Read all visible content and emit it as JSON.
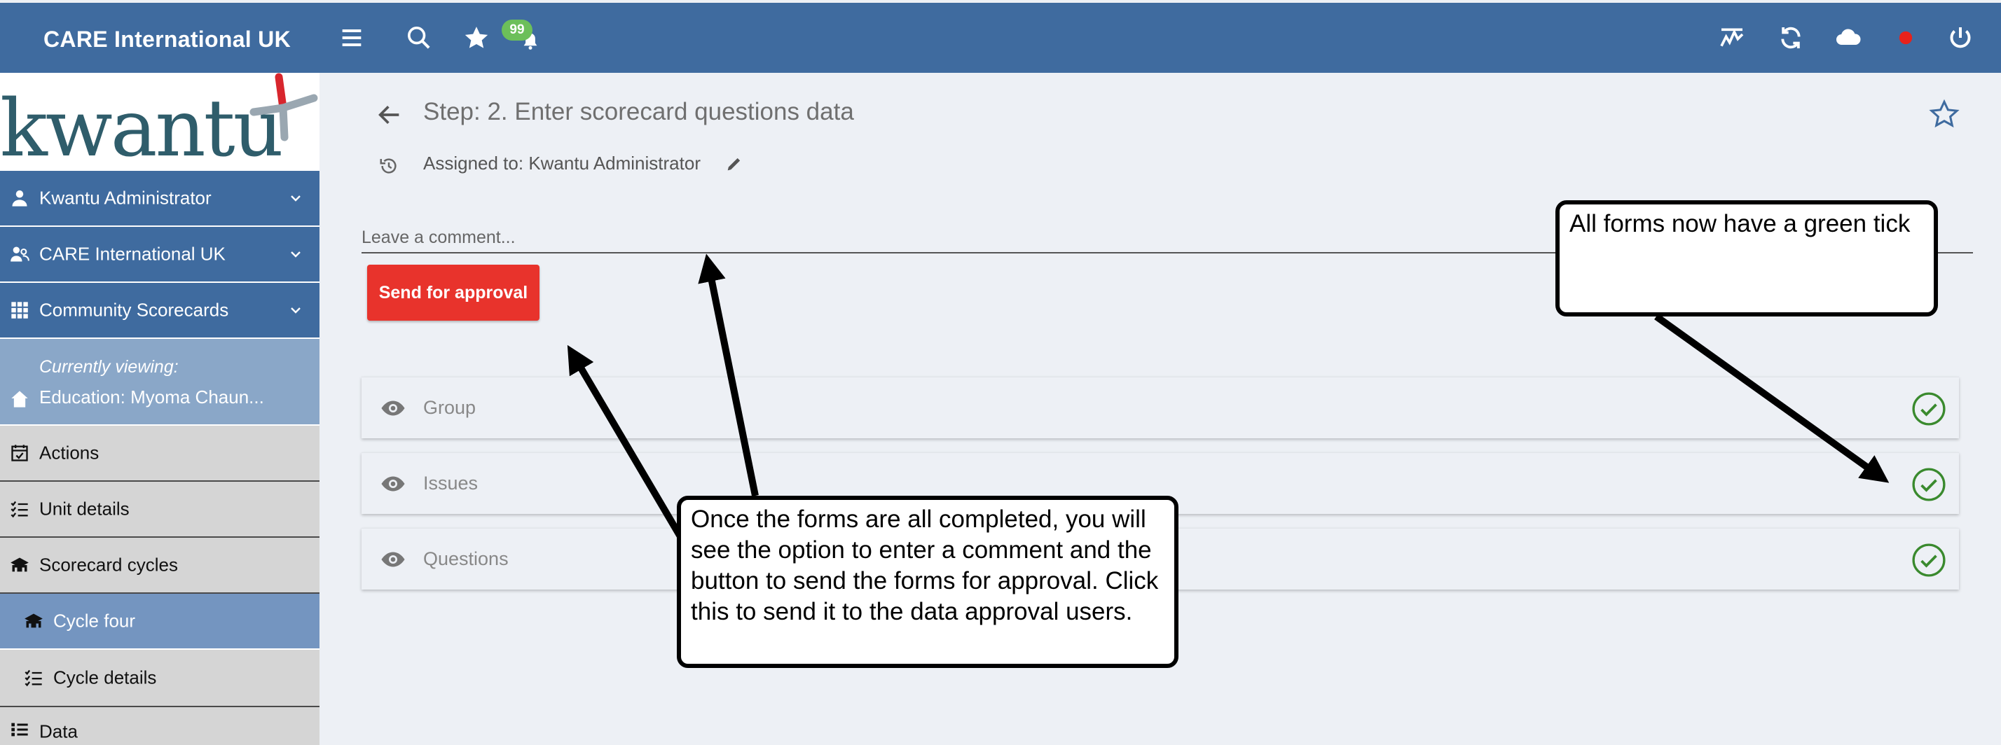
{
  "header": {
    "org_name": "CARE International UK",
    "notification_count": "99",
    "icons": [
      "menu-icon",
      "search-icon",
      "star-icon",
      "bell-icon",
      "activity-icon",
      "sync-icon",
      "cloud-icon",
      "status-dot-icon",
      "power-icon"
    ],
    "status_dot_color": "#e8221b"
  },
  "sidebar": {
    "logo_text": "kwantu",
    "user": "Kwantu Administrator",
    "organisation": "CARE International UK",
    "app": "Community Scorecards",
    "viewing_label": "Currently viewing:",
    "viewing_value": "Education: Myoma Chaun...",
    "items": {
      "actions": "Actions",
      "unit_details": "Unit details",
      "scorecard_cycles": "Scorecard cycles",
      "cycle_four": "Cycle four",
      "cycle_details": "Cycle details",
      "data": "Data"
    }
  },
  "main": {
    "step_title": "Step: 2. Enter scorecard questions data",
    "assigned_to": "Assigned to: Kwantu Administrator",
    "comment_placeholder": "Leave a comment...",
    "send_button": "Send for approval",
    "forms": [
      {
        "name": "Group",
        "status": "complete"
      },
      {
        "name": "Issues",
        "status": "complete"
      },
      {
        "name": "Questions",
        "status": "complete"
      }
    ],
    "tick_color": "#3a8a2e"
  },
  "annotations": {
    "callout_1": "All forms now have a green tick",
    "callout_2": "Once the forms are all completed, you will see the option to enter a comment and the button to send the forms for approval. Click this to send it to the data approval users."
  },
  "colors": {
    "brand_blue": "#3f6b9f",
    "send_red": "#e8332c",
    "badge_green": "#6cbf5a"
  }
}
